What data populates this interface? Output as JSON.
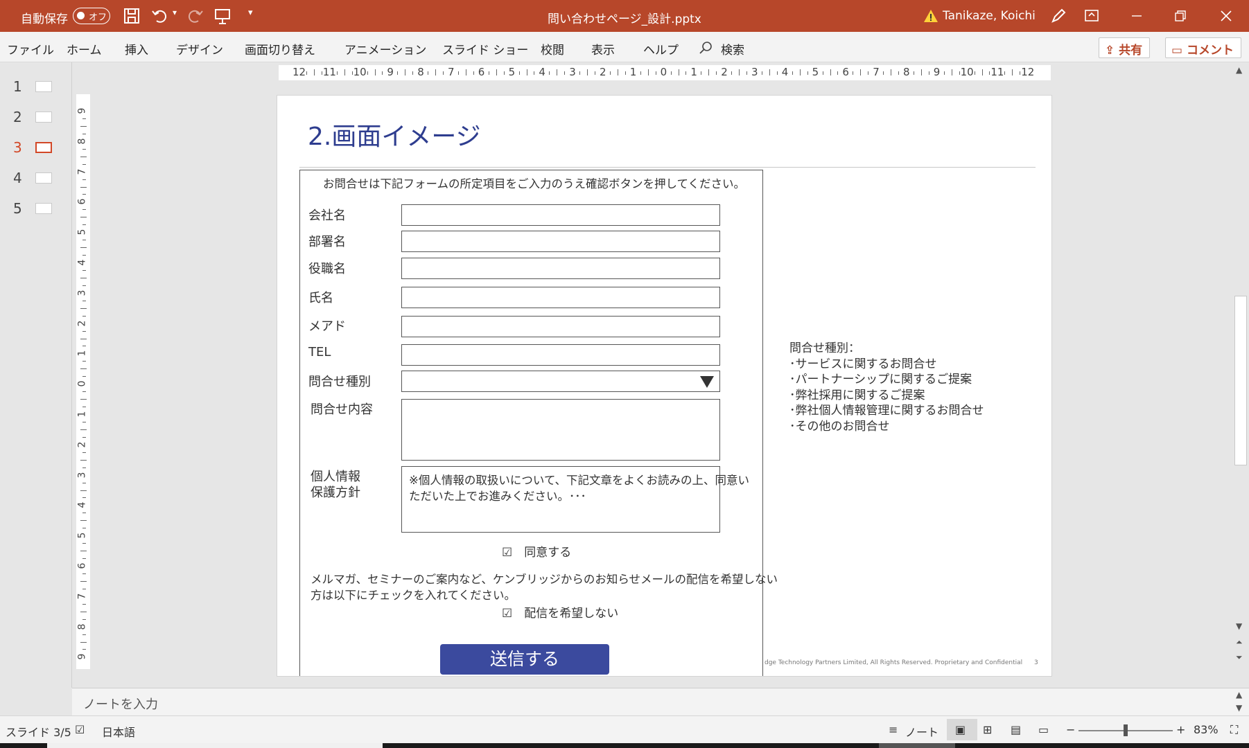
{
  "titlebar": {
    "autosave_label": "自動保存",
    "autosave_state": "オフ",
    "file_title": "問い合わせページ_設計.pptx",
    "user": "Tanikaze, Koichi",
    "warning_icon": "warning-icon",
    "color": "#b7472a"
  },
  "ribbon": {
    "tabs": [
      "ファイル",
      "ホーム",
      "挿入",
      "デザイン",
      "画面切り替え",
      "アニメーション",
      "スライド ショー",
      "校閲",
      "表示",
      "ヘルプ",
      "検索"
    ],
    "share_label": "共有",
    "comment_label": "コメント"
  },
  "thumbs": [
    "1",
    "2",
    "3",
    "4",
    "5"
  ],
  "ruler": {
    "h": [
      "12",
      "11",
      "10",
      "9",
      "8",
      "7",
      "6",
      "5",
      "4",
      "3",
      "2",
      "1",
      "0",
      "1",
      "2",
      "3",
      "4",
      "5",
      "6",
      "7",
      "8",
      "9",
      "10",
      "11",
      "12"
    ],
    "v": [
      "9",
      "8",
      "7",
      "6",
      "5",
      "4",
      "3",
      "2",
      "1",
      "0",
      "1",
      "2",
      "3",
      "4",
      "5",
      "6",
      "7",
      "8",
      "9"
    ]
  },
  "slide": {
    "title": "2.画面イメージ",
    "form": {
      "intro": "お問合せは下記フォームの所定項目をご入力のうえ確認ボタンを押してください。",
      "labels": {
        "company": "会社名",
        "dept": "部署名",
        "position": "役職名",
        "name": "氏名",
        "mail": "メアド",
        "tel": "TEL",
        "type": "問合せ種別",
        "content": "問合せ内容",
        "privacy1": "個人情報",
        "privacy2": "保護方針"
      },
      "privacy_text1": "※個人情報の取扱いについて、下記文章をよくお読みの上、同意い",
      "privacy_text2": "ただいた上でお進みください。･･･",
      "agree": "☑　同意する",
      "mail_text1": "メルマガ、セミナーのご案内など、ケンブリッジからのお知らせメールの配信を希望しない",
      "mail_text2": "方は以下にチェックを入れてください。",
      "no_mail": "☑　配信を希望しない",
      "submit": "送信する"
    },
    "note": {
      "title": "問合せ種別：",
      "items": [
        "･サービスに関するお問合せ",
        "･パートナーシップに関するご提案",
        "･弊社採用に関するご提案",
        "･弊社個人情報管理に関するお問合せ",
        "･その他のお問合せ"
      ]
    },
    "footer": "dge Technology Partners Limited,  All Rights Reserved. Proprietary and Confidential",
    "page": "3",
    "title_color": "#2e3d8f",
    "button_color": "#3b4a9e"
  },
  "notes_placeholder": "ノートを入力",
  "status": {
    "slide": "スライド 3/5",
    "lang": "日本語",
    "notes": "ノート",
    "zoom": "83%",
    "zoom_level": 0.5
  }
}
